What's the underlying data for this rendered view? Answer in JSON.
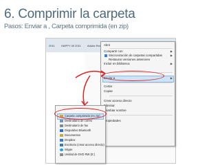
{
  "slide": {
    "title": "6. Comprimir la carpeta",
    "subtitle": "Pasos: Enviar a ,  Carpeta comprimida (en zip)"
  },
  "explorer": {
    "crumbs": [
      "2011",
      "HAPPY 00 2011",
      "Adobe Reader X"
    ],
    "file_rows": [
      "",
      "",
      "",
      "",
      "",
      "",
      "",
      "",
      "",
      "",
      "",
      "",
      "",
      ""
    ]
  },
  "context_menu": {
    "items": [
      {
        "label": "Abrir",
        "has_submenu": false
      },
      {
        "label": "Compartir con",
        "has_submenu": true
      },
      {
        "label": "Sincronización de carpetas compartidas",
        "has_submenu": true
      },
      {
        "label": "Restaurar versiones anteriores",
        "has_submenu": false
      },
      {
        "label": "Incluir en biblioteca",
        "has_submenu": true
      },
      {
        "label": "Enviar a",
        "has_submenu": true,
        "highlighted": true
      },
      {
        "label": "Cortar",
        "has_submenu": false
      },
      {
        "label": "Copiar",
        "has_submenu": false
      },
      {
        "label": "Crear acceso directo",
        "has_submenu": false
      },
      {
        "label": "Eliminar",
        "has_submenu": false
      },
      {
        "label": "Cambiar nombre",
        "has_submenu": false
      },
      {
        "label": "Propiedades",
        "has_submenu": false
      }
    ],
    "arrow_glyph": "▶"
  },
  "send_to_menu": {
    "items": [
      {
        "label": "Carpeta comprimida (en zip)",
        "highlighted": true,
        "icon": "zip-folder-icon",
        "color": "#d9a431"
      },
      {
        "label": "Destinatario de correo",
        "icon": "mail-icon",
        "color": "#6f93c6"
      },
      {
        "label": "Destinatario de fax",
        "icon": "fax-icon",
        "color": "#7f8a95"
      },
      {
        "label": "Dispositivo Bluetooth",
        "icon": "bluetooth-icon",
        "color": "#2a6fd1"
      },
      {
        "label": "Documentos",
        "icon": "documents-icon",
        "color": "#c9a84a"
      },
      {
        "label": "Dropbox",
        "icon": "dropbox-icon",
        "color": "#2d80d5"
      },
      {
        "label": "Escritorio (crear acceso directo)",
        "icon": "desktop-icon",
        "color": "#3b76b8"
      },
      {
        "label": "Skype",
        "icon": "skype-icon",
        "color": "#12a5e6"
      },
      {
        "label": "Unidad de DVD RW (E:)",
        "icon": "dvd-drive-icon",
        "color": "#8c8c8c"
      }
    ]
  },
  "colors": {
    "title": "#4f6a7e",
    "annotation": "#e02020",
    "highlight": "#cfe3f7"
  }
}
